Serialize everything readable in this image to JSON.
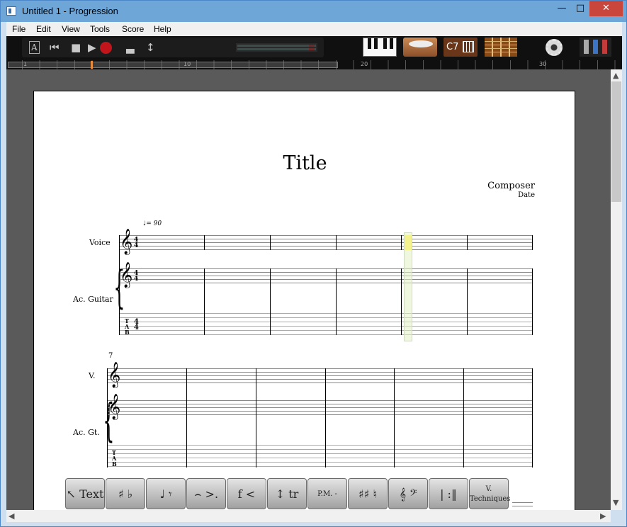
{
  "window": {
    "title": "Untitled 1 - Progression",
    "min_glyph": "—",
    "max_glyph": "□",
    "close_glyph": "✕"
  },
  "menu": {
    "items": [
      "File",
      "Edit",
      "View",
      "Tools",
      "Score",
      "Help"
    ]
  },
  "toolbar": {
    "text_tool_glyph": "A",
    "rewind_glyph": "⏮",
    "stop_glyph": "■",
    "play_glyph": "▶",
    "tempo_glyph": "▃",
    "updown_glyph": "↕",
    "chord_label": "C7"
  },
  "ruler": {
    "marks": [
      "1",
      "10",
      "20",
      "30"
    ]
  },
  "score": {
    "title": "Title",
    "composer": "Composer",
    "date": "Date",
    "tempo": "♩= 90",
    "measure_number": "7",
    "tracks_full": [
      "Voice",
      "Ac. Guitar"
    ],
    "tracks_short": [
      "V.",
      "Ac. Gt."
    ],
    "time_signature": "4",
    "treble_clef": "𝄞",
    "tab_label": "T\nA\nB"
  },
  "palette": {
    "buttons": [
      {
        "label": "↖ Text"
      },
      {
        "label": "♯ ♭"
      },
      {
        "label": "♩ 𝄾"
      },
      {
        "label": "⌢ >."
      },
      {
        "label": "f <"
      },
      {
        "label": "↕ tr"
      },
      {
        "label": "P.M. -"
      },
      {
        "label": "♯♯ ♮"
      },
      {
        "label": "𝄞 𝄢"
      },
      {
        "label": "| :‖"
      },
      {
        "label": "V.",
        "sub": "Techniques"
      }
    ]
  }
}
